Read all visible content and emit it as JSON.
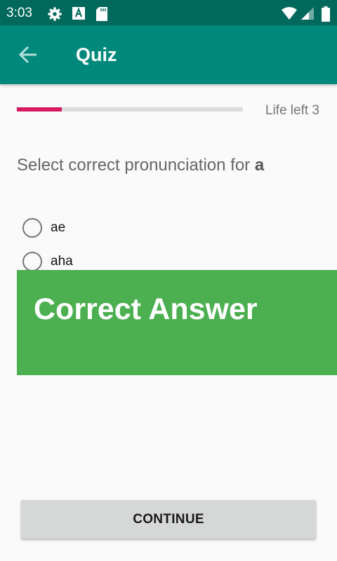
{
  "status_bar": {
    "time": "3:03",
    "icons": [
      "gear-icon",
      "a-badge-icon",
      "sd-card-icon",
      "wifi-icon",
      "signal-icon",
      "battery-icon"
    ]
  },
  "app_bar": {
    "title": "Quiz",
    "back_icon": "arrow-back-icon",
    "color": "#00897b"
  },
  "progress": {
    "fraction": 0.2,
    "fill_color": "#d81b60",
    "life_label": "Life left 3"
  },
  "question": {
    "prefix": "Select correct pronunciation for ",
    "target": "a"
  },
  "options": [
    {
      "label": "ae",
      "selected": false
    },
    {
      "label": "aha",
      "selected": false
    }
  ],
  "feedback": {
    "text": "Correct Answer",
    "color": "#4caf50"
  },
  "continue_button": {
    "label": "CONTINUE"
  }
}
